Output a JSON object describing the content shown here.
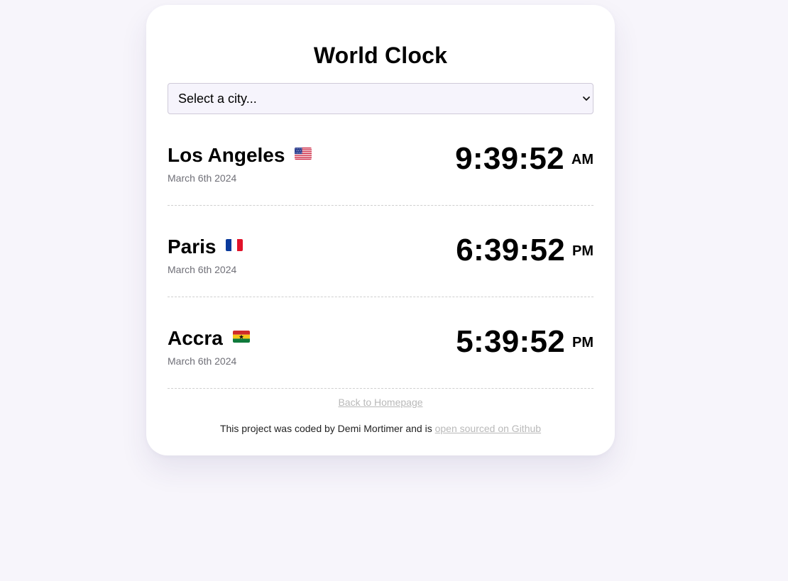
{
  "app": {
    "title": "World Clock"
  },
  "city_select": {
    "selected_label": "Select a city..."
  },
  "cities": [
    {
      "name": "Los Angeles",
      "flag_icon": "us-flag-icon",
      "date": "March 6th 2024",
      "time": "9:39:52",
      "period": "AM"
    },
    {
      "name": "Paris",
      "flag_icon": "fr-flag-icon",
      "date": "March 6th 2024",
      "time": "6:39:52",
      "period": "PM"
    },
    {
      "name": "Accra",
      "flag_icon": "gh-flag-icon",
      "date": "March 6th 2024",
      "time": "5:39:52",
      "period": "PM"
    }
  ],
  "links": {
    "back_home": "Back to Homepage"
  },
  "footer": {
    "credit_text": "This project was coded by Demi Mortimer and is ",
    "github_link": "open sourced on Github"
  },
  "colors": {
    "page_background": "#f7f5fb",
    "card_background": "#ffffff",
    "muted_link": "#b9b9b9",
    "date_text": "#6f6f77",
    "divider": "#cfcfcf"
  }
}
